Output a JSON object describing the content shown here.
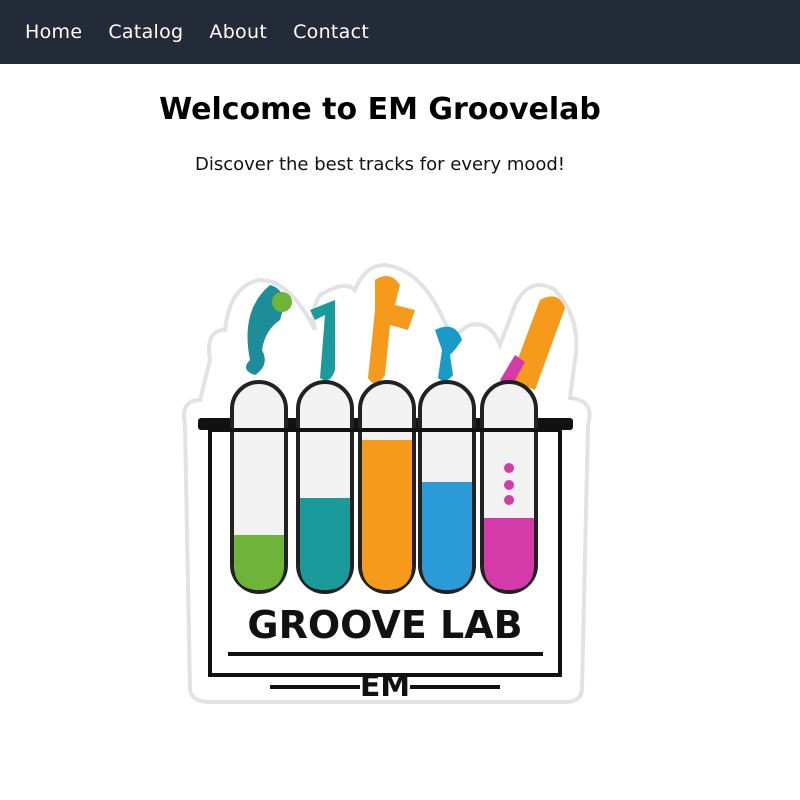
{
  "nav": {
    "items": [
      {
        "label": "Home"
      },
      {
        "label": "Catalog"
      },
      {
        "label": "About"
      },
      {
        "label": "Contact"
      }
    ]
  },
  "header": {
    "title": "Welcome to EM Groovelab",
    "subtitle": "Discover the best tracks for every mood!"
  },
  "logo": {
    "text_main": "GROOVE LAB",
    "text_sub": "EM",
    "colors": {
      "green": "#6fb43a",
      "teal": "#1a9a9a",
      "orange": "#f59a1b",
      "blue": "#2a9bd6",
      "magenta": "#d43ba8",
      "frame": "#111111",
      "nav_bg": "#232a38"
    }
  }
}
